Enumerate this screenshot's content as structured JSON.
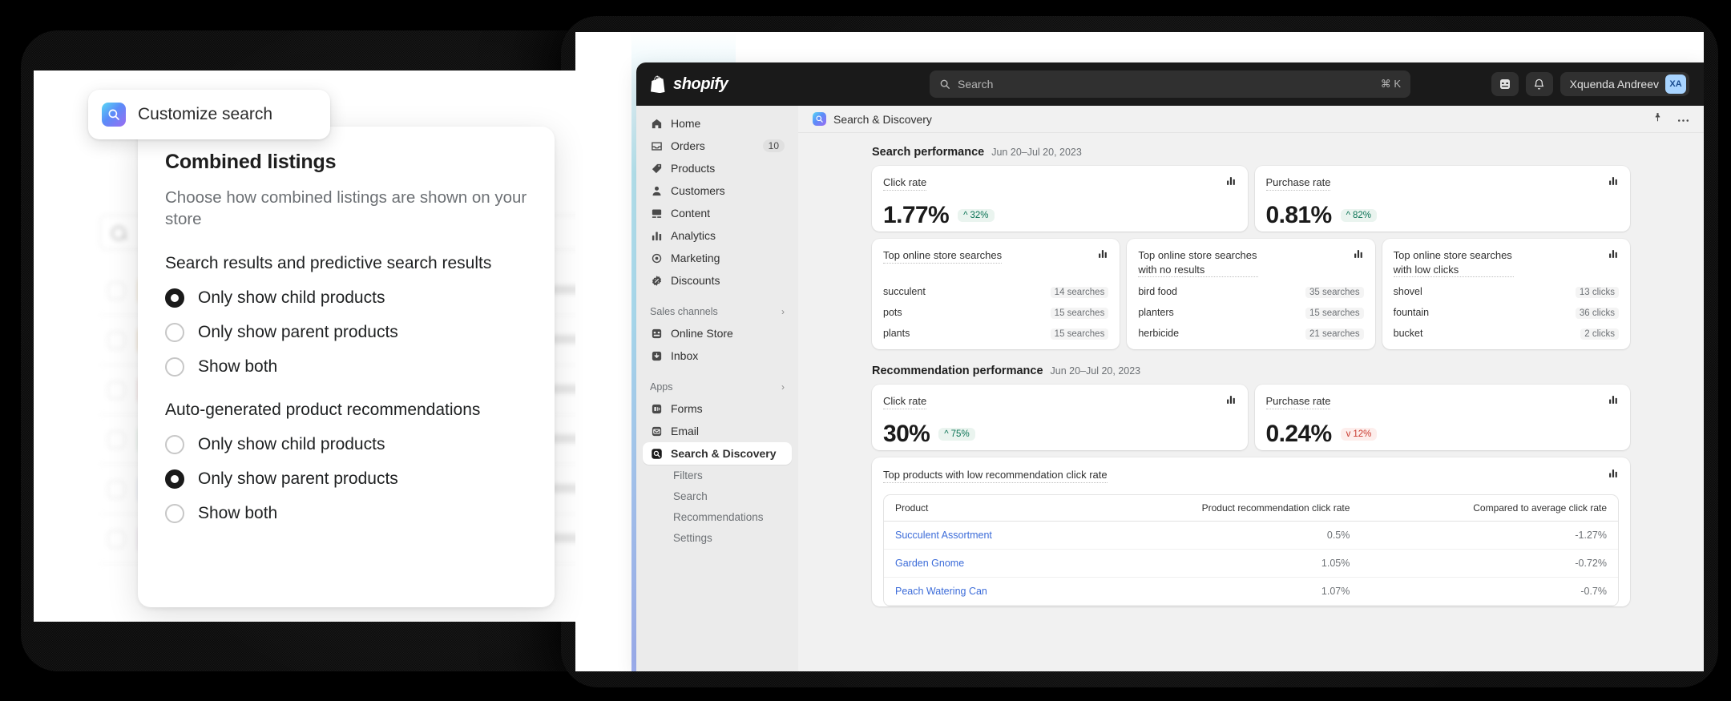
{
  "left_panel": {
    "pill": {
      "icon": "search-app-icon",
      "label": "Customize search"
    },
    "card": {
      "heading": "Combined listings",
      "description": "Choose how combined listings are shown on your store",
      "groups": [
        {
          "title": "Search results and predictive search results",
          "options": [
            {
              "label": "Only show child products",
              "selected": true
            },
            {
              "label": "Only show parent products",
              "selected": false
            },
            {
              "label": "Show both",
              "selected": false
            }
          ]
        },
        {
          "title": "Auto-generated product recommendations",
          "options": [
            {
              "label": "Only show child products",
              "selected": false
            },
            {
              "label": "Only show parent products",
              "selected": true
            },
            {
              "label": "Show both",
              "selected": false
            }
          ]
        }
      ]
    }
  },
  "admin": {
    "topbar": {
      "brand": "shopify",
      "search_placeholder": "Search",
      "search_shortcut": "⌘ K",
      "user_name": "Xquenda Andreev",
      "user_initials": "XA"
    },
    "sidebar": {
      "main": [
        {
          "label": "Home",
          "icon": "home-icon",
          "badge": ""
        },
        {
          "label": "Orders",
          "icon": "orders-icon",
          "badge": "10"
        },
        {
          "label": "Products",
          "icon": "products-icon",
          "badge": ""
        },
        {
          "label": "Customers",
          "icon": "customers-icon",
          "badge": ""
        },
        {
          "label": "Content",
          "icon": "content-icon",
          "badge": ""
        },
        {
          "label": "Analytics",
          "icon": "analytics-icon",
          "badge": ""
        },
        {
          "label": "Marketing",
          "icon": "marketing-icon",
          "badge": ""
        },
        {
          "label": "Discounts",
          "icon": "discounts-icon",
          "badge": ""
        }
      ],
      "sales_channels_label": "Sales channels",
      "sales_channels": [
        {
          "label": "Online Store",
          "icon": "online-store-icon"
        },
        {
          "label": "Inbox",
          "icon": "inbox-icon"
        }
      ],
      "apps_label": "Apps",
      "apps": [
        {
          "label": "Forms",
          "icon": "forms-icon",
          "active": false
        },
        {
          "label": "Email",
          "icon": "email-icon",
          "active": false
        },
        {
          "label": "Search & Discovery",
          "icon": "search-discovery-icon",
          "active": true
        }
      ],
      "sub_items": [
        "Filters",
        "Search",
        "Recommendations",
        "Settings"
      ]
    },
    "content_header": {
      "title": "Search & Discovery",
      "actions": [
        "pin-icon",
        "more-icon"
      ]
    },
    "search_performance": {
      "title": "Search performance",
      "date_range": "Jun 20–Jul 20, 2023",
      "rates": [
        {
          "title": "Click rate",
          "value": "1.77%",
          "delta": "32%",
          "direction": "up"
        },
        {
          "title": "Purchase rate",
          "value": "0.81%",
          "delta": "82%",
          "direction": "up"
        }
      ],
      "lists": [
        {
          "title": "Top online store searches",
          "rows": [
            {
              "term": "succulent",
              "count": "14 searches"
            },
            {
              "term": "pots",
              "count": "15 searches"
            },
            {
              "term": "plants",
              "count": "15 searches"
            }
          ]
        },
        {
          "title": "Top online store searches with no results",
          "rows": [
            {
              "term": "bird food",
              "count": "35 searches"
            },
            {
              "term": "planters",
              "count": "15 searches"
            },
            {
              "term": "herbicide",
              "count": "21 searches"
            }
          ]
        },
        {
          "title": "Top online store searches with low clicks",
          "rows": [
            {
              "term": "shovel",
              "count": "13 clicks"
            },
            {
              "term": "fountain",
              "count": "36 clicks"
            },
            {
              "term": "bucket",
              "count": "2 clicks"
            }
          ]
        }
      ]
    },
    "recommendation_performance": {
      "title": "Recommendation performance",
      "date_range": "Jun 20–Jul 20, 2023",
      "rates": [
        {
          "title": "Click rate",
          "value": "30%",
          "delta": "75%",
          "direction": "up"
        },
        {
          "title": "Purchase rate",
          "value": "0.24%",
          "delta": "12%",
          "direction": "down"
        }
      ]
    },
    "products_card": {
      "title": "Top products with low recommendation click rate",
      "columns": [
        "Product",
        "Product recommendation click rate",
        "Compared to average click rate"
      ],
      "rows": [
        {
          "product": "Succulent Assortment",
          "click_rate": "0.5%",
          "compared": "-1.27%"
        },
        {
          "product": "Garden Gnome",
          "click_rate": "1.05%",
          "compared": "-0.72%"
        },
        {
          "product": "Peach Watering Can",
          "click_rate": "1.07%",
          "compared": "-0.7%"
        }
      ]
    }
  }
}
